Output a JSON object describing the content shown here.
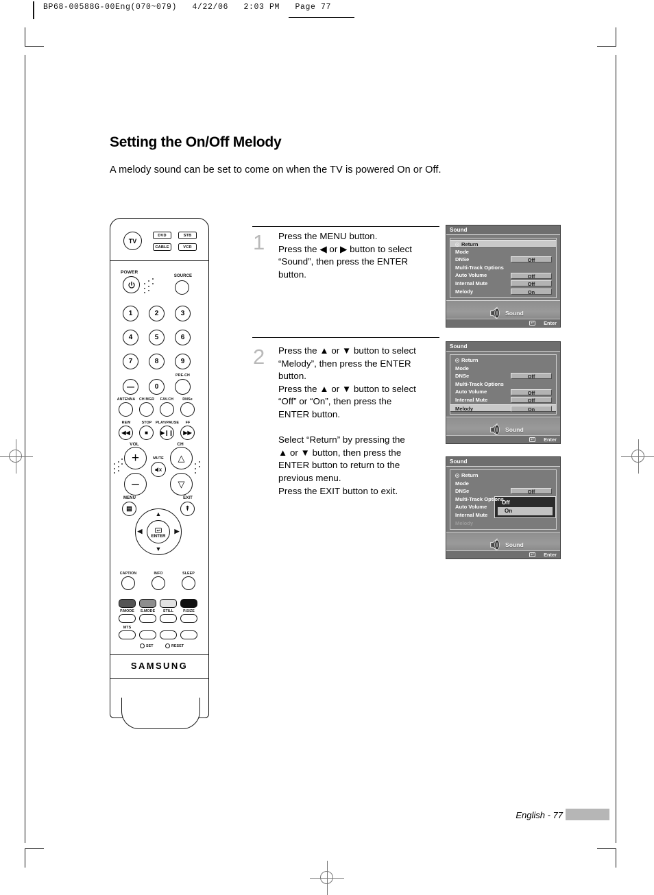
{
  "print_header": {
    "text": "BP68-00588G-00Eng(070~079)   4/22/06   2:03 PM   Page 77"
  },
  "page": {
    "title": "Setting the On/Off Melody",
    "intro": "A melody sound can be set to come on when the TV is powered On or Off.",
    "footer_label": "English - 77"
  },
  "steps": [
    {
      "number": "1",
      "text": "Press the MENU button.\nPress the ◀ or ▶ button to select\n“Sound”, then press the ENTER\nbutton."
    },
    {
      "number": "2",
      "text": "Press the ▲ or ▼ button to select\n“Melody”, then press the ENTER\nbutton.\nPress the ▲ or ▼ button to select\n“Off” or “On”, then press the\nENTER button.\n\nSelect “Return” by pressing the\n▲ or ▼ button, then press the\nENTER button to return to the\nprevious menu.\nPress the EXIT button to exit."
    }
  ],
  "osd_panels": [
    {
      "title": "Sound",
      "rows": [
        {
          "label": "Return",
          "value": "",
          "state": "highlight",
          "icon": "return-icon"
        },
        {
          "label": "Mode",
          "value": "",
          "state": "normal"
        },
        {
          "label": "DNSe",
          "value": "Off",
          "state": "normal"
        },
        {
          "label": "Multi-Track Options",
          "value": "",
          "state": "normal"
        },
        {
          "label": "Auto Volume",
          "value": "Off",
          "state": "normal"
        },
        {
          "label": "Internal Mute",
          "value": "Off",
          "state": "normal"
        },
        {
          "label": "Melody",
          "value": "On",
          "state": "normal"
        }
      ],
      "footer_name": "Sound",
      "enter_label": "Enter",
      "dropdown": null
    },
    {
      "title": "Sound",
      "rows": [
        {
          "label": "Return",
          "value": "",
          "state": "normal",
          "icon": "return-icon"
        },
        {
          "label": "Mode",
          "value": "",
          "state": "normal"
        },
        {
          "label": "DNSe",
          "value": "Off",
          "state": "normal"
        },
        {
          "label": "Multi-Track Options",
          "value": "",
          "state": "normal"
        },
        {
          "label": "Auto Volume",
          "value": "Off",
          "state": "normal"
        },
        {
          "label": "Internal Mute",
          "value": "Off",
          "state": "normal"
        },
        {
          "label": "Melody",
          "value": "On",
          "state": "highlight"
        }
      ],
      "footer_name": "Sound",
      "enter_label": "Enter",
      "dropdown": null
    },
    {
      "title": "Sound",
      "rows": [
        {
          "label": "Return",
          "value": "",
          "state": "normal",
          "icon": "return-icon"
        },
        {
          "label": "Mode",
          "value": "",
          "state": "normal"
        },
        {
          "label": "DNSe",
          "value": "Off",
          "state": "normal"
        },
        {
          "label": "Multi-Track Options",
          "value": "",
          "state": "normal"
        },
        {
          "label": "Auto Volume",
          "value": "",
          "state": "normal"
        },
        {
          "label": "Internal Mute",
          "value": "",
          "state": "normal"
        },
        {
          "label": "Melody",
          "value": "",
          "state": "dim"
        }
      ],
      "footer_name": "Sound",
      "enter_label": "Enter",
      "dropdown": {
        "options": [
          {
            "label": "Off",
            "selected": false
          },
          {
            "label": "On",
            "selected": true
          }
        ]
      }
    }
  ],
  "remote": {
    "brand": "SAMSUNG",
    "tv_button": "TV",
    "source_buttons": [
      "DVD",
      "STB",
      "CABLE",
      "VCR"
    ],
    "power_label": "POWER",
    "source_label": "SOURCE",
    "digits": [
      "1",
      "2",
      "3",
      "4",
      "5",
      "6",
      "7",
      "8",
      "9",
      "—",
      "0"
    ],
    "pre_ch": "PRE-CH",
    "function_row": [
      "ANTENNA",
      "CH MGR",
      "FAV.CH",
      "DNSe"
    ],
    "transport": [
      "REW",
      "STOP",
      "PLAY/PAUSE",
      "FF"
    ],
    "vol_label": "VOL",
    "ch_label": "CH",
    "mute_label": "MUTE",
    "menu_label": "MENU",
    "exit_label": "EXIT",
    "enter_label": "ENTER",
    "bottom_row": [
      "CAPTION",
      "INFO",
      "SLEEP"
    ],
    "color_row": [
      "P.MODE",
      "S.MODE",
      "STILL",
      "P.SIZE"
    ],
    "mts_label": "MTS",
    "set_label": "SET",
    "reset_label": "RESET",
    "color_swatches": [
      "#555555",
      "#8d8d8d",
      "#e2e2e2",
      "#101010"
    ]
  }
}
